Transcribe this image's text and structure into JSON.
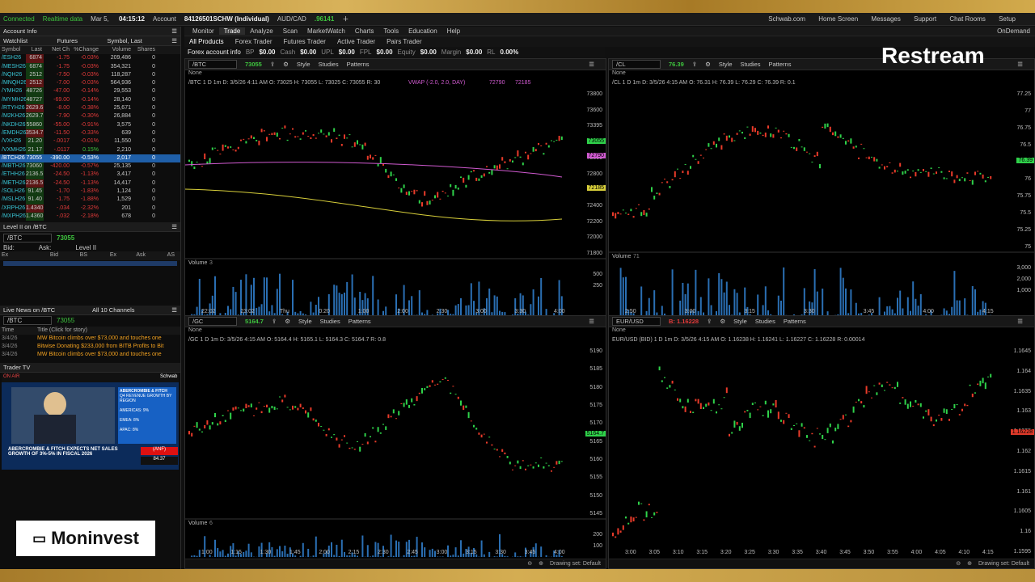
{
  "titlebar": {
    "status": "Connected",
    "realtime": "Realtime data",
    "date": "Mar 5,",
    "time": "04:15:12",
    "account_label": "Account",
    "account": "84126501SCHW (Individual)",
    "pair": "AUD/CAD",
    "pair_price": ".96141",
    "links": [
      "Schwab.com",
      "Home Screen",
      "Messages",
      "Support",
      "Chat Rooms",
      "Setup"
    ]
  },
  "nav": {
    "tabs": [
      "Monitor",
      "Trade",
      "Analyze",
      "Scan",
      "MarketWatch",
      "Charts",
      "Tools",
      "Education",
      "Help"
    ],
    "active": "Trade",
    "ondemand": "OnDemand"
  },
  "subnav": {
    "items": [
      "All Products",
      "Forex Trader",
      "Futures Trader",
      "Active Trader",
      "Pairs Trader"
    ]
  },
  "acct": {
    "label": "Forex account info",
    "bp": "BP",
    "bp_v": "$0.00",
    "cash": "Cash",
    "cash_v": "$0.00",
    "upl": "UPL",
    "upl_v": "$0.00",
    "fpl": "FPL",
    "fpl_v": "$0.00",
    "equity": "Equity",
    "equity_v": "$0.00",
    "margin": "Margin",
    "margin_v": "$0.00",
    "rl": "RL",
    "rl_v": "0.00%"
  },
  "left": {
    "account_info": "Account Info",
    "watchlist": "Watchlist",
    "watchlist_name": "Futures",
    "watch_sort": "Symbol, Last",
    "cols": [
      "Symbol",
      "Last",
      "Net Ch",
      "%Change",
      "Volume",
      "Shares"
    ],
    "rows": [
      [
        "/ESH26",
        "6874",
        "-1.75",
        "-0.03%",
        "209,486",
        "0"
      ],
      [
        "/MESH26",
        "6874",
        "-1.75",
        "-0.03%",
        "354,321",
        "0"
      ],
      [
        "/NQH26",
        "2512",
        "-7.50",
        "-0.03%",
        "118,287",
        "0"
      ],
      [
        "/MNQH26",
        "2512",
        "-7.00",
        "-0.03%",
        "564,936",
        "0"
      ],
      [
        "/YMH26",
        "48726",
        "-47.00",
        "-0.14%",
        "29,553",
        "0"
      ],
      [
        "/MYMH26",
        "48727",
        "-69.00",
        "-0.14%",
        "28,140",
        "0"
      ],
      [
        "/RTYH26",
        "2629.6",
        "-8.00",
        "-0.38%",
        "25,671",
        "0"
      ],
      [
        "/M2KH26",
        "2629.7",
        "-7.90",
        "-0.30%",
        "26,884",
        "0"
      ],
      [
        "/NKDH26",
        "55860",
        "-55.00",
        "-0.91%",
        "3,575",
        "0"
      ],
      [
        "/EMDH26",
        "3534.7",
        "-11.50",
        "-0.33%",
        "639",
        "0"
      ],
      [
        "/VXH26",
        "21.20",
        "-.0017",
        "-0.01%",
        "11,550",
        "0"
      ],
      [
        "/VXMH26",
        "21.17",
        "-.0117",
        "0.15%",
        "2,210",
        "0"
      ],
      [
        "/BTCH26",
        "73055",
        "-390.00",
        "-0.53%",
        "2,017",
        "0"
      ],
      [
        "/MBTH26",
        "73060",
        "-420.00",
        "-0.57%",
        "25,135",
        "0"
      ],
      [
        "/ETHH26",
        "2136.5",
        "-24.50",
        "-1.13%",
        "3,417",
        "0"
      ],
      [
        "/METH26",
        "2136.5",
        "-24.50",
        "-1.13%",
        "14,417",
        "0"
      ],
      [
        "/SOLH26",
        "91.45",
        "-1.70",
        "-1.83%",
        "1,124",
        "0"
      ],
      [
        "/MSLH26",
        "91.40",
        "-1.75",
        "-1.88%",
        "1,529",
        "0"
      ],
      [
        "/XRPH26",
        "1.4340",
        "-.034",
        "-2.32%",
        "201",
        "0"
      ],
      [
        "/MXPH26",
        "1.4360",
        "-.032",
        "-2.18%",
        "678",
        "0"
      ]
    ],
    "selected_row": 12,
    "level2": "Level II on /BTC",
    "l2_symbol": "/BTC",
    "l2_price": "73055",
    "bid": "Bid:",
    "ask": "Ask:",
    "level2_label": "Level II",
    "l2_cols": [
      "Ex",
      "Bid",
      "BS",
      "Ex",
      "Ask",
      "AS"
    ],
    "news": "Live News on /BTC",
    "news_channels": "All 10 Channels",
    "news_symbol": "/BTC",
    "news_price": "73055",
    "news_cols": [
      "Time",
      "Title (Click for story)"
    ],
    "news_rows": [
      [
        "3/4/26",
        "MW Bitcoin climbs over $73,000 and touches one"
      ],
      [
        "3/4/26",
        "Bitwise Donating $233,000 from BITB Profits to Bit"
      ],
      [
        "3/4/26",
        "MW Bitcoin climbs over $73,000 and touches one"
      ]
    ],
    "trader_tv": "Trader TV",
    "tv_headline": "ABERCROMBIE & FITCH EXPECTS NET SALES GROWTH OF 3%-5% IN FISCAL 2026",
    "tv_ticker": "(ANF)",
    "tv_live": "ON AIR",
    "tv_brand": "Schwab",
    "tv_box_title": "ABERCROMBIE & FITCH",
    "tv_box_sub": "Q4 REVENUE GROWTH BY REGION",
    "tv_box_rows": [
      "AMERICAS: 9%",
      "EMEA: 8%",
      "APAC: 8%"
    ],
    "tv_price": "84.37"
  },
  "charts": [
    {
      "id": "btc",
      "symbol": "/BTC",
      "price": "73055",
      "info": "/BTC 1 D 1m   D: 3/5/26 4:11 AM   O: 73025   H: 73055   L: 73025   C: 73055   R: 30",
      "study": "VWAP (-2.0, 2.0, DAY)",
      "study_v": "72790",
      "study_v2": "72185",
      "yticks": [
        "73800",
        "73600",
        "73395",
        "73200",
        "73000",
        "72800",
        "72600",
        "72400",
        "72200",
        "72000",
        "71800"
      ],
      "xticks": [
        "22:02",
        "23:02",
        "Thu",
        "0:20",
        "1:00",
        "2:00",
        "2:30",
        "3:00",
        "3:30",
        "4:00"
      ],
      "volume": "Volume",
      "vol_v": "3",
      "vol_ticks": [
        "500",
        "250"
      ],
      "tag": "73055",
      "tag2": "72790",
      "tag3": "72185",
      "drawing": "Drawing set: Default"
    },
    {
      "id": "cl",
      "symbol": "/CL",
      "price": "76.39",
      "info": "/CL 1 D 1m   D: 3/5/26 4:15 AM   O: 76.31   H: 76.39   L: 76.29   C: 76.39   R: 0.1",
      "yticks": [
        "77.25",
        "77",
        "76.75",
        "76.5",
        "76.25",
        "76",
        "75.75",
        "75.5",
        "75.25",
        "75"
      ],
      "xticks": [
        "2:50",
        "3:00",
        "3:15",
        "3:30",
        "3:45",
        "4:00",
        "4:15"
      ],
      "volume": "Volume",
      "vol_v": "71",
      "vol_ticks": [
        "3,000",
        "2,000",
        "1,000"
      ],
      "tag": "76.39",
      "drawing": "Drawing set: Default"
    },
    {
      "id": "gc",
      "symbol": "/GC",
      "price": "5164.7",
      "info": "/GC 1 D 1m   D: 3/5/26 4:15 AM   O: 5164.4   H: 5165.1   L: 5164.3   C: 5164.7   R: 0.8",
      "yticks": [
        "5190",
        "5185",
        "5180",
        "5175",
        "5170",
        "5165",
        "5160",
        "5155",
        "5150",
        "5145"
      ],
      "xticks": [
        "1:00",
        "1:15",
        "1:30",
        "1:45",
        "2:00",
        "2:15",
        "2:30",
        "2:45",
        "3:00",
        "3:15",
        "3:30",
        "3:45",
        "4:00"
      ],
      "volume": "Volume",
      "vol_v": "6",
      "vol_ticks": [
        "200",
        "100"
      ],
      "tag": "5164.7",
      "drawing": "Drawing set: Default"
    },
    {
      "id": "eur",
      "symbol": "EUR/USD",
      "price": "B: 1.16228",
      "info": "EUR/USD (BID) 1 D 1m   D: 3/5/26 4:15 AM   O: 1.16238   H: 1.16241   L: 1.16227   C: 1.16228   R: 0.00014",
      "yticks": [
        "1.1645",
        "1.164",
        "1.1635",
        "1.163",
        "1.1625",
        "1.162",
        "1.1615",
        "1.161",
        "1.1605",
        "1.16",
        "1.1595"
      ],
      "xticks": [
        "3:00",
        "3:05",
        "3:10",
        "3:15",
        "3:20",
        "3:25",
        "3:30",
        "3:35",
        "3:40",
        "3:45",
        "3:50",
        "3:55",
        "4:00",
        "4:05",
        "4:10",
        "4:15"
      ],
      "tag": "1.16228",
      "drawing": "Drawing set: Default"
    }
  ],
  "toolbar": {
    "style": "Style",
    "studies": "Studies",
    "patterns": "Patterns",
    "none": "None"
  },
  "overlay": {
    "restream": "Restream",
    "moninvest": "Moninvest"
  }
}
